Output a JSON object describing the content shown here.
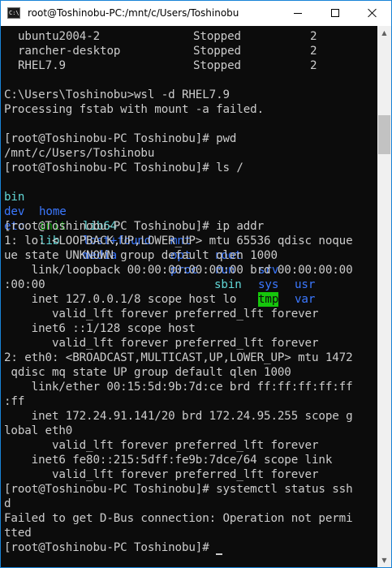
{
  "window": {
    "title": "root@Toshinobu-PC:/mnt/c/Users/Toshinobu",
    "app_icon_text": "C:\\."
  },
  "scrollbar": {
    "up_glyph": "▲",
    "down_glyph": "▼"
  },
  "terminal": {
    "wsl_rows": [
      {
        "name": "ubuntu2004-2",
        "state": "Stopped",
        "version": "2"
      },
      {
        "name": "rancher-desktop",
        "state": "Stopped",
        "version": "2"
      },
      {
        "name": "RHEL7.9",
        "state": "Stopped",
        "version": "2"
      }
    ],
    "cmd_wsl": "C:\\Users\\Toshinobu>wsl -d RHEL7.9",
    "fstab_error": "Processing fstab with mount -a failed.",
    "prompt": "[root@Toshinobu-PC Toshinobu]# ",
    "cmd_pwd": "pwd",
    "pwd_output": "/mnt/c/Users/Toshinobu",
    "cmd_ls": "ls /",
    "ls_items": [
      "bin",
      "home",
      "lib64",
      "mnt",
      "root",
      "srv",
      "usr",
      "dev",
      "init",
      "lost+found",
      "opt",
      "run",
      "sys",
      "var",
      "etc",
      "lib",
      "media",
      "proc",
      "sbin",
      "tmp"
    ],
    "cmd_ip": "ip addr",
    "ip_lines": [
      "1: lo: <LOOPBACK,UP,LOWER_UP> mtu 65536 qdisc noque",
      "ue state UNKNOWN group default qlen 1000",
      "    link/loopback 00:00:00:00:00:00 brd 00:00:00:00",
      ":00:00",
      "    inet 127.0.0.1/8 scope host lo",
      "       valid_lft forever preferred_lft forever",
      "    inet6 ::1/128 scope host",
      "       valid_lft forever preferred_lft forever",
      "2: eth0: <BROADCAST,MULTICAST,UP,LOWER_UP> mtu 1472",
      " qdisc mq state UP group default qlen 1000",
      "    link/ether 00:15:5d:9b:7d:ce brd ff:ff:ff:ff:ff",
      ":ff",
      "    inet 172.24.91.141/20 brd 172.24.95.255 scope g",
      "lobal eth0",
      "       valid_lft forever preferred_lft forever",
      "    inet6 fe80::215:5dff:fe9b:7dce/64 scope link",
      "       valid_lft forever preferred_lft forever"
    ],
    "cmd_systemctl_1": "systemctl status ssh",
    "cmd_systemctl_2": "d",
    "dbus_error_1": "Failed to get D-Bus connection: Operation not permi",
    "dbus_error_2": "tted"
  }
}
